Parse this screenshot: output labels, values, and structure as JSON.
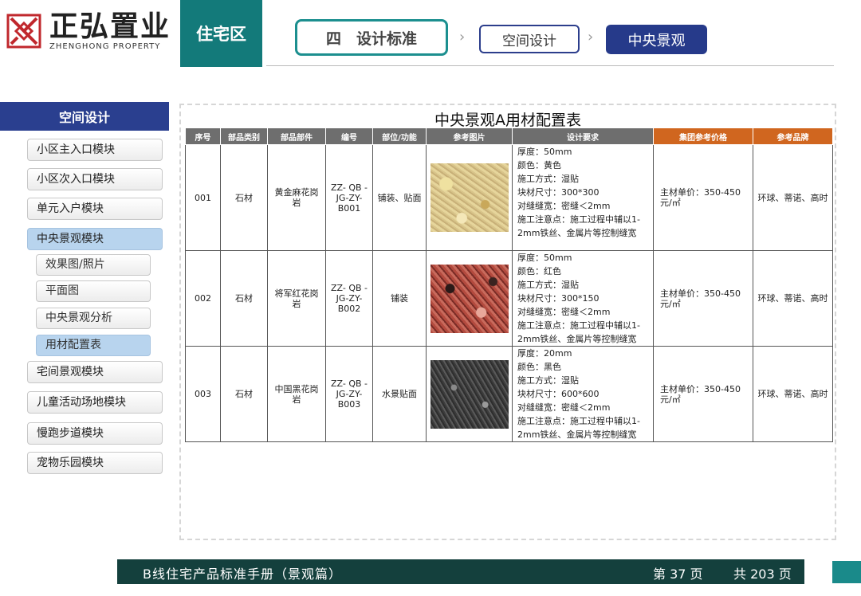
{
  "header": {
    "brand_cn": "正弘置业",
    "brand_en": "ZHENGHONG PROPERTY",
    "zone": "住宅区",
    "crumbs": [
      "四　设计标准",
      "空间设计",
      "中央景观"
    ],
    "arrow": "›"
  },
  "sidebar": {
    "title": "空间设计",
    "items": [
      {
        "label": "小区主入口模块"
      },
      {
        "label": "小区次入口模块"
      },
      {
        "label": "单元入户模块"
      },
      {
        "label": "中央景观模块"
      },
      {
        "label": "宅间景观模块"
      },
      {
        "label": "儿童活动场地模块"
      },
      {
        "label": "慢跑步道模块"
      },
      {
        "label": "宠物乐园模块"
      }
    ],
    "subitems": [
      {
        "label": "效果图/照片"
      },
      {
        "label": "平面图"
      },
      {
        "label": "中央景观分析"
      },
      {
        "label": "用材配置表"
      }
    ]
  },
  "table": {
    "title": "中央景观A用材配置表",
    "headers": [
      "序号",
      "部品类别",
      "部品部件",
      "编号",
      "部位/功能",
      "参考图片",
      "设计要求",
      "集团参考价格",
      "参考品牌"
    ],
    "rows": [
      {
        "no": "001",
        "category": "石材",
        "part": "黄金麻花岗岩",
        "code": "ZZ- QB -JG-ZY-B001",
        "position": "铺装、贴面",
        "req": [
          "厚度：50mm",
          "颜色：黄色",
          "施工方式：湿贴",
          "块材尺寸：300*300",
          "对缝缝宽：密缝＜2mm",
          "施工注意点：施工过程中辅以1-2mm铁丝、金属片等控制缝宽"
        ],
        "price": "主材单价：350-450元/㎡",
        "brand": "环球、蒂诺、高时"
      },
      {
        "no": "002",
        "category": "石材",
        "part": "将军红花岗岩",
        "code": "ZZ- QB -JG-ZY-B002",
        "position": "铺装",
        "req": [
          "厚度：50mm",
          "颜色：红色",
          "施工方式：湿贴",
          "块材尺寸：300*150",
          "对缝缝宽：密缝＜2mm",
          "施工注意点：施工过程中辅以1-2mm铁丝、金属片等控制缝宽"
        ],
        "price": "主材单价：350-450元/㎡",
        "brand": "环球、蒂诺、高时"
      },
      {
        "no": "003",
        "category": "石材",
        "part": "中国黑花岗岩",
        "code": "ZZ- QB -JG-ZY-B003",
        "position": "水景贴面",
        "req": [
          "厚度：20mm",
          "颜色：黑色",
          "施工方式：湿贴",
          "块材尺寸：600*600",
          "对缝缝宽：密缝＜2mm",
          "施工注意点：施工过程中辅以1-2mm铁丝、金属片等控制缝宽"
        ],
        "price": "主材单价：350-450元/㎡",
        "brand": "环球、蒂诺、高时"
      }
    ]
  },
  "footer": {
    "title": "B线住宅产品标准手册（景观篇）",
    "page": "第 37 页",
    "total": "共 203 页"
  },
  "colors": {
    "teal": "#137a7a",
    "navy": "#263a8a",
    "orange": "#d0661f",
    "footer": "#14403d"
  }
}
